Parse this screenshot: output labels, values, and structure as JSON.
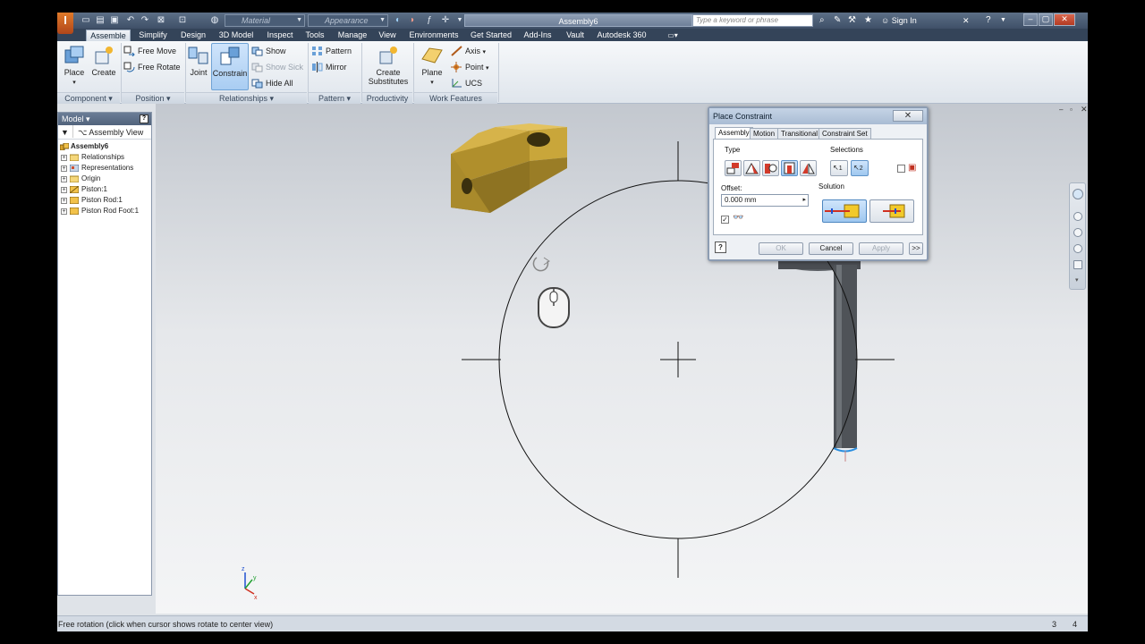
{
  "titlebar": {
    "app_logo": "I",
    "material_placeholder": "Material",
    "appearance_placeholder": "Appearance",
    "document_title": "Assembly6",
    "search_placeholder": "Type a keyword or phrase",
    "sign_in": "Sign In"
  },
  "tabs": [
    "Assemble",
    "Simplify",
    "Design",
    "3D Model",
    "Inspect",
    "Tools",
    "Manage",
    "View",
    "Environments",
    "Get Started",
    "Add-Ins",
    "Vault",
    "Autodesk 360"
  ],
  "ribbon": {
    "component": {
      "label": "Component ▾",
      "place": "Place",
      "create": "Create"
    },
    "position": {
      "label": "Position ▾",
      "free_move": "Free Move",
      "free_rotate": "Free Rotate"
    },
    "relationships": {
      "label": "Relationships ▾",
      "joint": "Joint",
      "constrain": "Constrain",
      "show": "Show",
      "show_sick": "Show Sick",
      "hide_all": "Hide All"
    },
    "pattern": {
      "label": "Pattern ▾",
      "pattern": "Pattern",
      "mirror": "Mirror"
    },
    "productivity": {
      "label": "Productivity",
      "create_substitutes_1": "Create",
      "create_substitutes_2": "Substitutes"
    },
    "work_features": {
      "label": "Work Features",
      "plane": "Plane",
      "axis": "Axis",
      "point": "Point",
      "ucs": "UCS"
    }
  },
  "browser": {
    "header": "Model ▾",
    "view": "Assembly View",
    "tree": [
      {
        "label": "Assembly6",
        "bold": true
      },
      {
        "label": "Relationships"
      },
      {
        "label": "Representations"
      },
      {
        "label": "Origin"
      },
      {
        "label": "Piston:1"
      },
      {
        "label": "Piston Rod:1"
      },
      {
        "label": "Piston Rod Foot:1"
      }
    ]
  },
  "dialog": {
    "title": "Place Constraint",
    "tabs": [
      "Assembly",
      "Motion",
      "Transitional",
      "Constraint Set"
    ],
    "type_label": "Type",
    "selections_label": "Selections",
    "offset_label": "Offset:",
    "offset_value": "0.000 mm",
    "solution_label": "Solution",
    "ok": "OK",
    "cancel": "Cancel",
    "apply": "Apply",
    "more": ">>",
    "sel1": "1",
    "sel2": "2",
    "preview_checked": true
  },
  "status": {
    "message": "Free rotation (click when cursor shows rotate to center view)",
    "count_a": "3",
    "count_b": "4"
  },
  "colors": {
    "accent": "#6fa3d6",
    "ribbon_dark": "#344459",
    "part_brass": "#c9a63a"
  }
}
